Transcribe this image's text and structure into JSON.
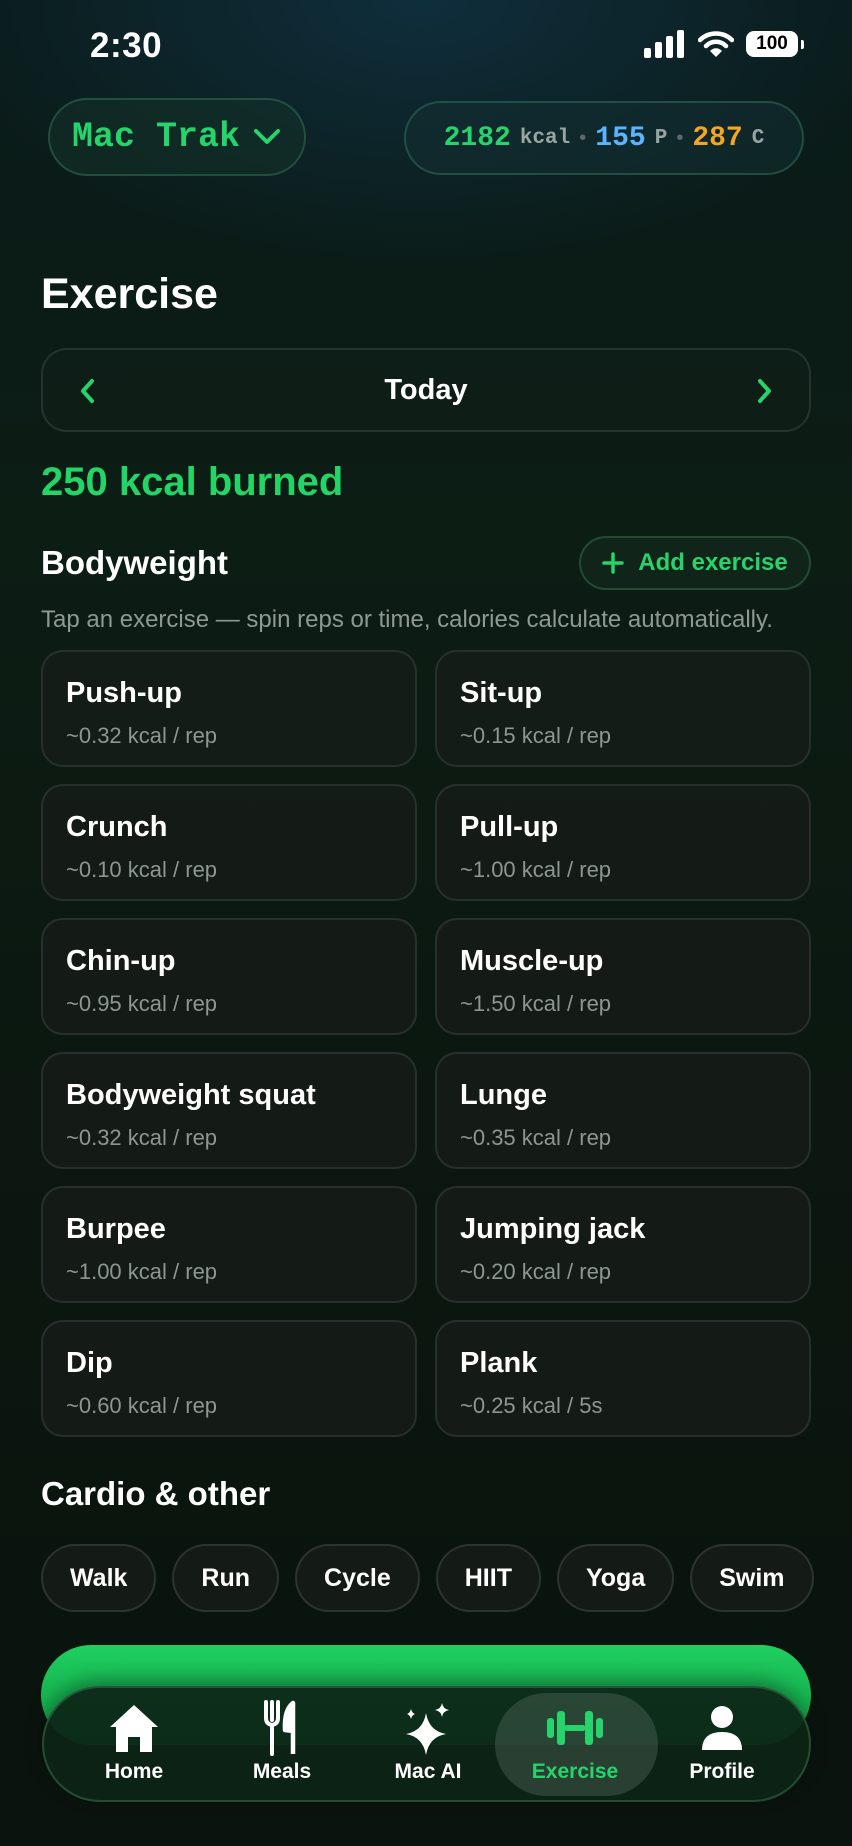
{
  "status_bar": {
    "time": "2:30",
    "battery": "100"
  },
  "header": {
    "app_name": "Mac Trak",
    "macros": {
      "kcal_value": "2182",
      "kcal_unit": "kcal",
      "protein_value": "155",
      "protein_unit": "P",
      "carbs_value": "287",
      "carbs_unit": "C",
      "colors": {
        "kcal": "#27d36b",
        "protein": "#5ab4ff",
        "carbs": "#f2a623"
      }
    }
  },
  "page": {
    "title": "Exercise",
    "date_label": "Today",
    "burned_summary": "250 kcal burned"
  },
  "bodyweight": {
    "title": "Bodyweight",
    "add_label": "Add exercise",
    "hint": "Tap an exercise — spin reps or time, calories calculate automatically.",
    "exercises": [
      {
        "name": "Push-up",
        "rate": "~0.32 kcal / rep"
      },
      {
        "name": "Sit-up",
        "rate": "~0.15 kcal / rep"
      },
      {
        "name": "Crunch",
        "rate": "~0.10 kcal / rep"
      },
      {
        "name": "Pull-up",
        "rate": "~1.00 kcal / rep"
      },
      {
        "name": "Chin-up",
        "rate": "~0.95 kcal / rep"
      },
      {
        "name": "Muscle-up",
        "rate": "~1.50 kcal / rep"
      },
      {
        "name": "Bodyweight squat",
        "rate": "~0.32 kcal / rep"
      },
      {
        "name": "Lunge",
        "rate": "~0.35 kcal / rep"
      },
      {
        "name": "Burpee",
        "rate": "~1.00 kcal / rep"
      },
      {
        "name": "Jumping jack",
        "rate": "~0.20 kcal / rep"
      },
      {
        "name": "Dip",
        "rate": "~0.60 kcal / rep"
      },
      {
        "name": "Plank",
        "rate": "~0.25 kcal / 5s"
      }
    ]
  },
  "cardio": {
    "title": "Cardio & other",
    "chips": [
      "Walk",
      "Run",
      "Cycle",
      "HIIT",
      "Yoga",
      "Swim"
    ]
  },
  "tabbar": {
    "items": [
      {
        "label": "Home",
        "icon": "home-icon"
      },
      {
        "label": "Meals",
        "icon": "fork-knife-icon"
      },
      {
        "label": "Mac AI",
        "icon": "sparkles-icon"
      },
      {
        "label": "Exercise",
        "icon": "dumbbell-icon",
        "active": true
      },
      {
        "label": "Profile",
        "icon": "person-icon"
      }
    ],
    "accent_color": "#27d36b"
  }
}
